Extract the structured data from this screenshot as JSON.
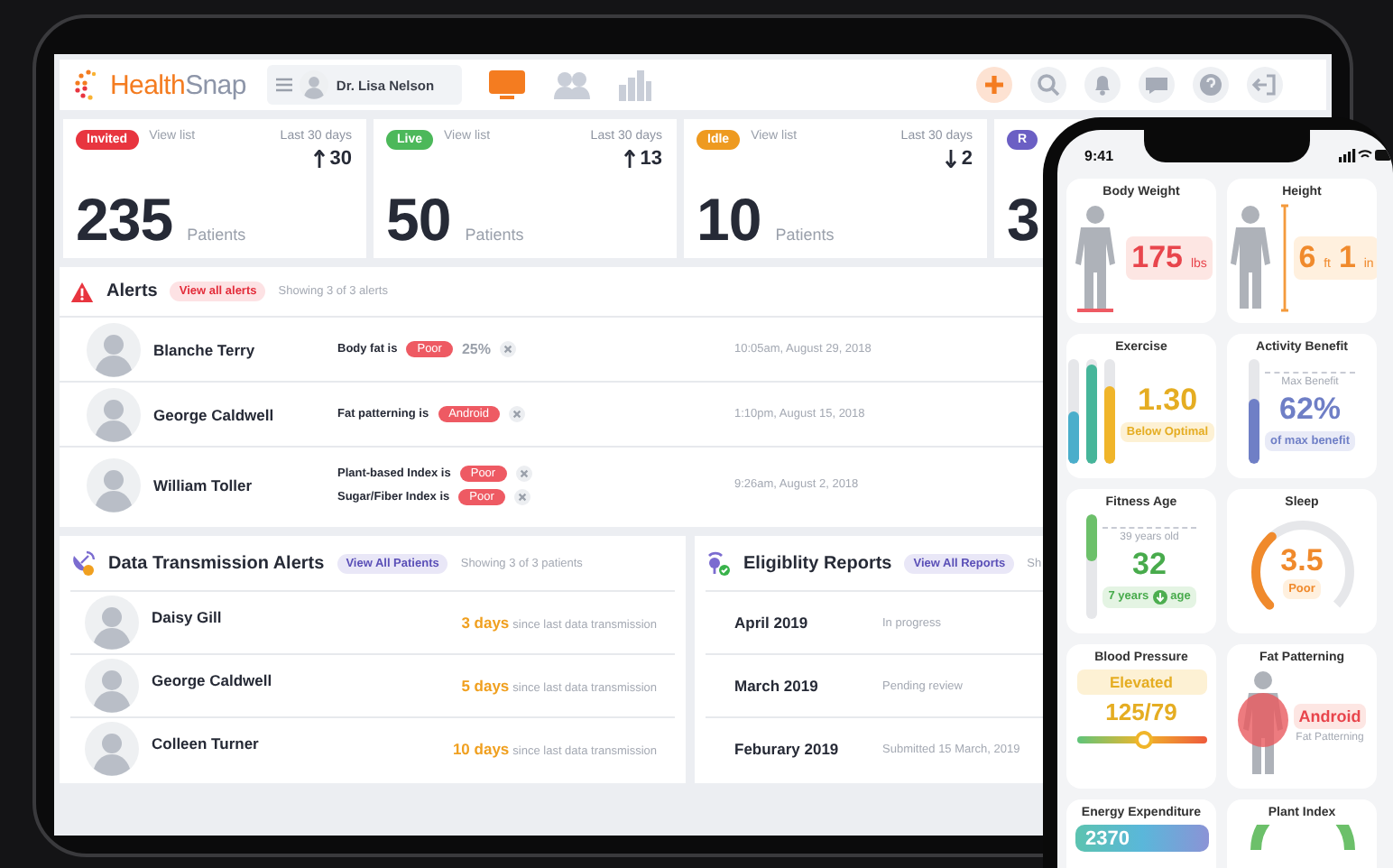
{
  "app": {
    "logo_first": "Health",
    "logo_second": "Snap",
    "user": "Dr. Lisa Nelson",
    "nav": [
      {
        "kind": "monitor",
        "selected": true
      },
      {
        "kind": "people",
        "selected": false
      },
      {
        "kind": "chart",
        "selected": false
      }
    ],
    "actions": [
      {
        "kind": "plus"
      },
      {
        "kind": "search"
      },
      {
        "kind": "bell"
      },
      {
        "kind": "chat"
      },
      {
        "kind": "help"
      },
      {
        "kind": "exit"
      }
    ]
  },
  "stats": [
    {
      "badge": "Invited",
      "color": "#e8353f",
      "link": "View list",
      "period": "Last 30 days",
      "rising": true,
      "change": "30",
      "count": "235",
      "unit": "Patients"
    },
    {
      "badge": "Live",
      "color": "#4cb85a",
      "link": "View list",
      "period": "Last 30 days",
      "rising": true,
      "change": "13",
      "count": "50",
      "unit": "Patients"
    },
    {
      "badge": "Idle",
      "color": "#ee9a20",
      "link": "View list",
      "period": "Last 30 days",
      "rising": false,
      "change": "2",
      "count": "10",
      "unit": "Patients"
    },
    {
      "badge": "R",
      "color": "#6b5fc4",
      "count": "3"
    }
  ],
  "alerts": {
    "title": "Alerts",
    "button": "View all alerts",
    "summary": "Showing 3 of 3 alerts",
    "rows": [
      {
        "name": "Blanche Terry",
        "findings": [
          {
            "label": "Body fat is",
            "badge": "Poor",
            "value": "25%"
          }
        ],
        "time": "10:05am, August 29, 2018"
      },
      {
        "name": "George Caldwell",
        "findings": [
          {
            "label": "Fat patterning is",
            "badge": "Android"
          }
        ],
        "time": "1:10pm, August 15, 2018"
      },
      {
        "name": "William Toller",
        "findings": [
          {
            "label": "Plant-based Index is",
            "badge": "Poor"
          },
          {
            "label": "Sugar/Fiber Index is",
            "badge": "Poor"
          }
        ],
        "time": "9:26am, August 2, 2018"
      }
    ]
  },
  "transmission": {
    "title": "Data Transmission Alerts",
    "button": "View All Patients",
    "summary": "Showing 3 of 3 patients",
    "rows": [
      {
        "name": "Daisy Gill",
        "days": "3 days",
        "note": "since last data transmission"
      },
      {
        "name": "George Caldwell",
        "days": "5 days",
        "note": "since last data transmission"
      },
      {
        "name": "Colleen Turner",
        "days": "10 days",
        "note": "since last data transmission"
      }
    ]
  },
  "eligibility": {
    "title": "Eligiblity Reports",
    "button": "View All Reports",
    "summary": "Sh",
    "rows": [
      {
        "month": "April 2019",
        "status": "In progress"
      },
      {
        "month": "March 2019",
        "status": "Pending review"
      },
      {
        "month": "Feburary 2019",
        "status": "Submitted 15 March, 2019"
      }
    ]
  },
  "phone": {
    "time": "9:41",
    "cards": [
      {
        "kind": "weight",
        "title": "Body Weight",
        "value": "175",
        "unit": "lbs"
      },
      {
        "kind": "height",
        "title": "Height",
        "feet": "6",
        "feet_unit": "ft",
        "inches": "1",
        "inches_unit": "in"
      },
      {
        "kind": "exercise",
        "title": "Exercise",
        "bars": [
          {
            "level": 0.5
          },
          {
            "level": 0.95
          },
          {
            "level": 0.75
          }
        ],
        "value": "1.30",
        "status": "Below Optimal"
      },
      {
        "kind": "benefit",
        "title": "Activity Benefit",
        "max_label": "Max Benefit",
        "level": 0.62,
        "value": "62%",
        "caption": "of max benefit"
      },
      {
        "kind": "fitness",
        "title": "Fitness Age",
        "reference": "39 years old",
        "level": 0.45,
        "value": "32",
        "delta": "7 years",
        "delta_unit": "age"
      },
      {
        "kind": "sleep",
        "title": "Sleep",
        "level": 0.35,
        "value": "3.5",
        "status": "Poor"
      },
      {
        "kind": "pressure",
        "title": "Blood Pressure",
        "status": "Elevated",
        "value": "125/79",
        "level": 0.52
      },
      {
        "kind": "fat",
        "title": "Fat Patterning",
        "value": "Android",
        "caption": "Fat Patterning"
      },
      {
        "kind": "energy",
        "title": "Energy Expenditure",
        "value": "2370"
      },
      {
        "kind": "plant",
        "title": "Plant Index"
      }
    ]
  }
}
